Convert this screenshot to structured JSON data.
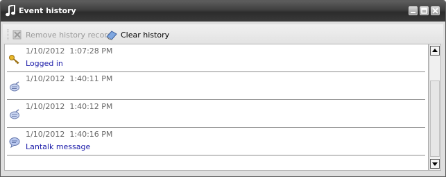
{
  "window": {
    "title": "Event history",
    "icon": "music-note-icon"
  },
  "title_buttons": {
    "minimize_icon": "minimize-icon",
    "maximize_icon": "maximize-icon",
    "close_icon": "close-icon"
  },
  "toolbar": {
    "remove_label": "Remove history record",
    "remove_icon": "remove-record-icon",
    "clear_label": "Clear history",
    "clear_icon": "eraser-icon"
  },
  "events": [
    {
      "time": "1/10/2012  1:07:28 PM",
      "message": "Logged in",
      "icon": "key-icon"
    },
    {
      "time": "1/10/2012  1:40:11 PM",
      "message": "",
      "icon": "chat-icon"
    },
    {
      "time": "1/10/2012  1:40:12 PM",
      "message": "",
      "icon": "chat-icon"
    },
    {
      "time": "1/10/2012  1:40:16 PM",
      "message": "Lantalk message",
      "icon": "speech-bubble-icon"
    }
  ],
  "colors": {
    "message_text": "#1a1aa8",
    "timestamp_text": "#666666",
    "titlebar": "#3e3e3e"
  }
}
